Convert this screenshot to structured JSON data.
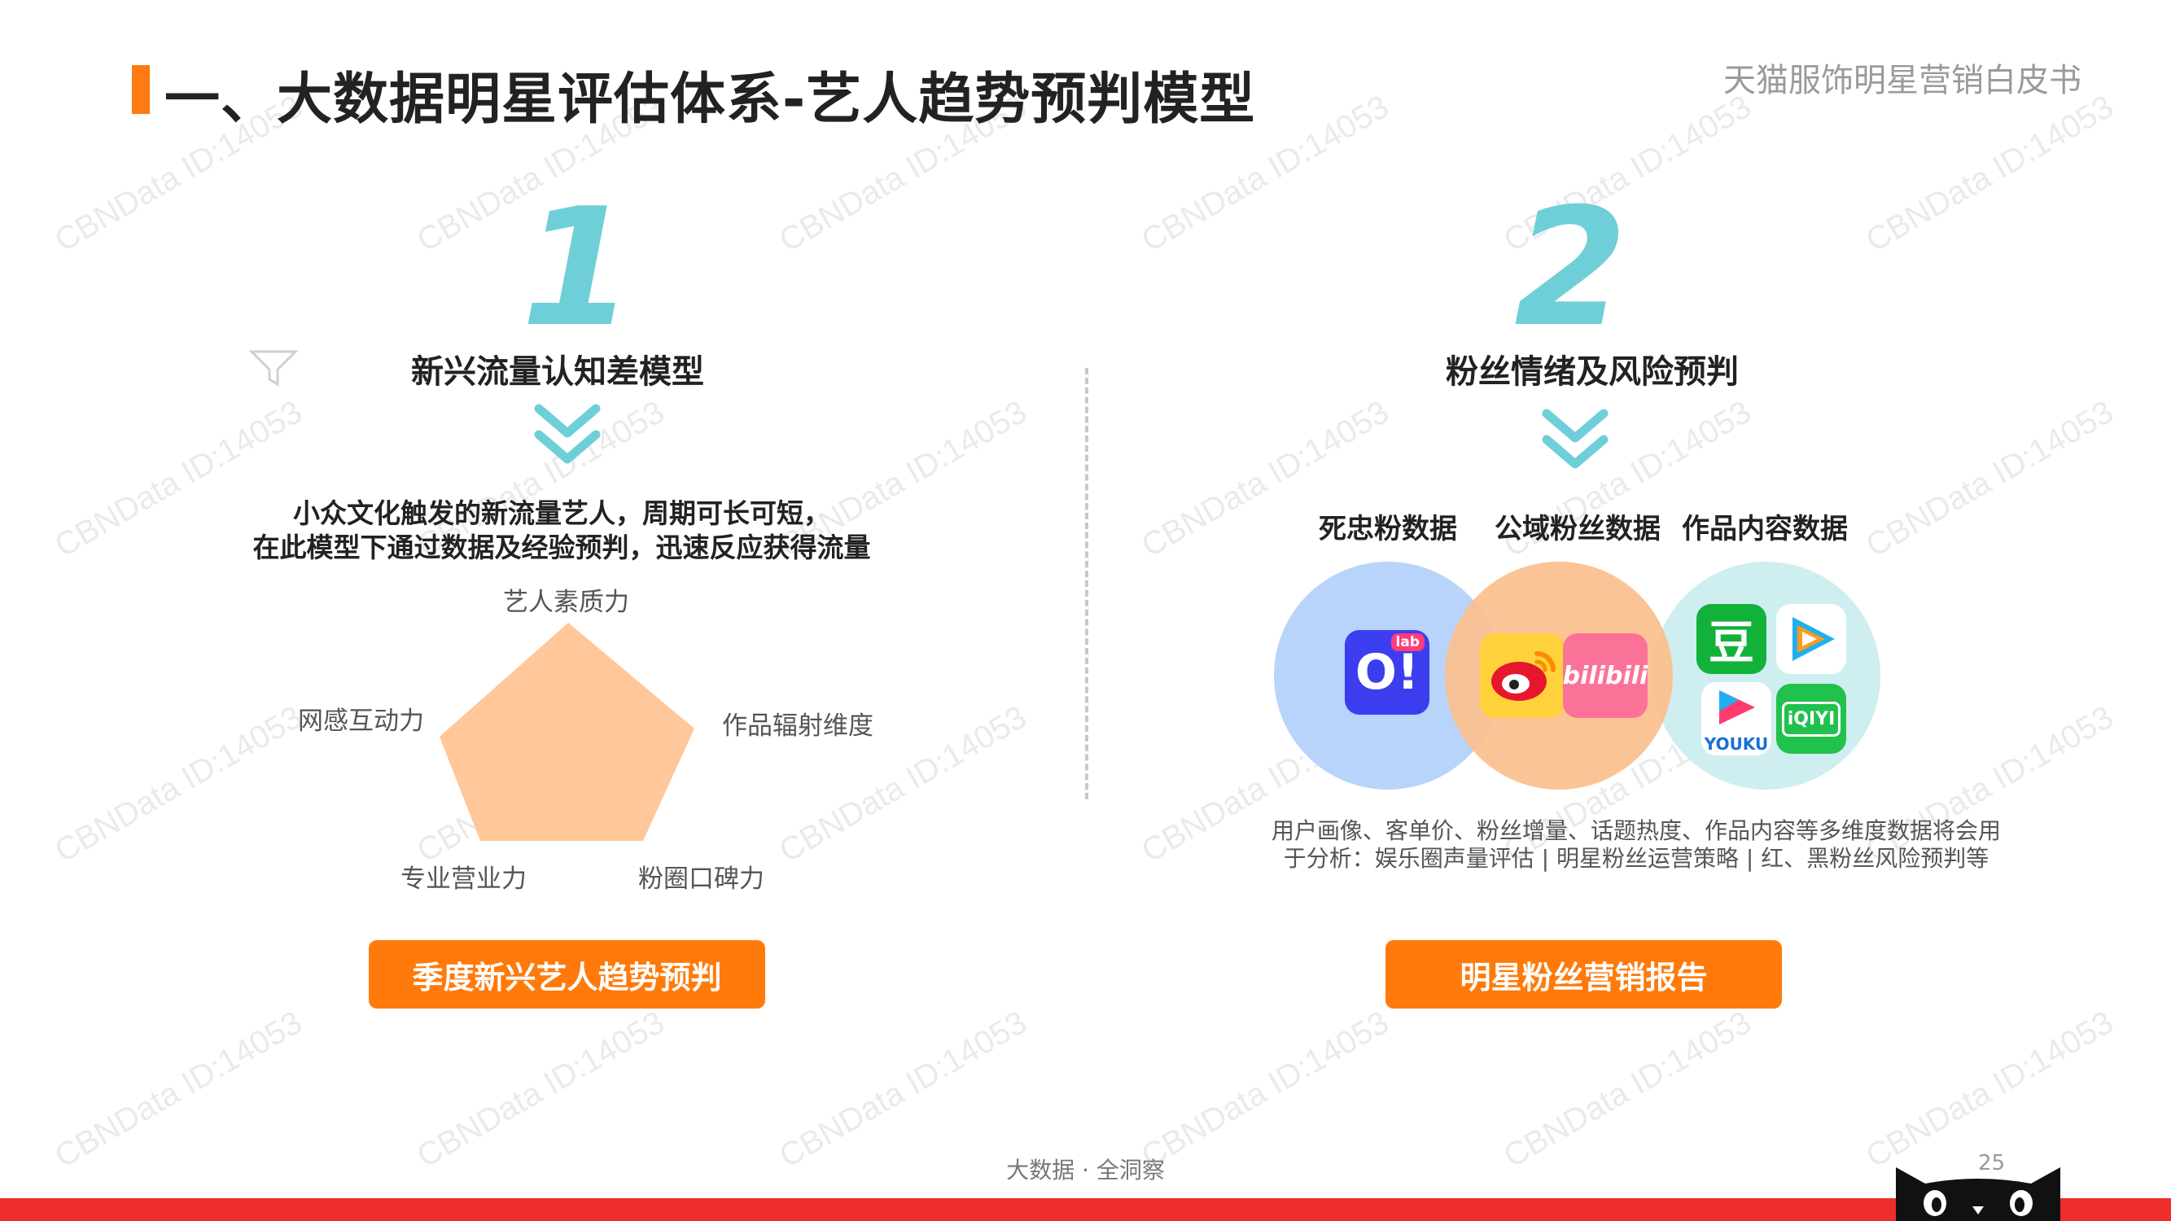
{
  "header": {
    "title": "一、大数据明星评估体系-艺人趋势预判模型",
    "brand": "天猫服饰明星营销白皮书"
  },
  "left": {
    "number": "1",
    "title": "新兴流量认知差模型",
    "desc_line1": "小众文化触发的新流量艺人，周期可长可短，",
    "desc_line2": "在此模型下通过数据及经验预判，迅速反应获得流量",
    "radar_labels": {
      "top": "艺人素质力",
      "right": "作品辐射维度",
      "bottom_right": "粉圈口碑力",
      "bottom_left": "专业营业力",
      "left": "网感互动力"
    },
    "button": "季度新兴艺人趋势预判"
  },
  "right": {
    "number": "2",
    "title": "粉丝情绪及风险预判",
    "data_labels": [
      "死忠粉数据",
      "公域粉丝数据",
      "作品内容数据"
    ],
    "icons": {
      "lab_badge": "lab",
      "bilibili": "bilibili",
      "douban": "豆",
      "youku": "YOUKU",
      "iqiyi": "iQIYI"
    },
    "note_line1": "用户画像、客单价、粉丝增量、话题热度、作品内容等多维度数据将会用",
    "note_line2": "于分析：娱乐圈声量评估 | 明星粉丝运营策略 | 红、黑粉丝风险预判等",
    "button": "明星粉丝营销报告"
  },
  "footer": {
    "text": "大数据 · 全洞察",
    "page": "25"
  },
  "watermark": "CBNData ID:14053",
  "colors": {
    "accent_orange": "#ff7a0a",
    "teal": "#6fcfd8",
    "radar_fill": "#ffc79a",
    "circle_blue": "#b8d4fb",
    "circle_orange": "#fbbf8d",
    "circle_teal": "#cfeef0",
    "footer_red": "#ee2e2b"
  }
}
